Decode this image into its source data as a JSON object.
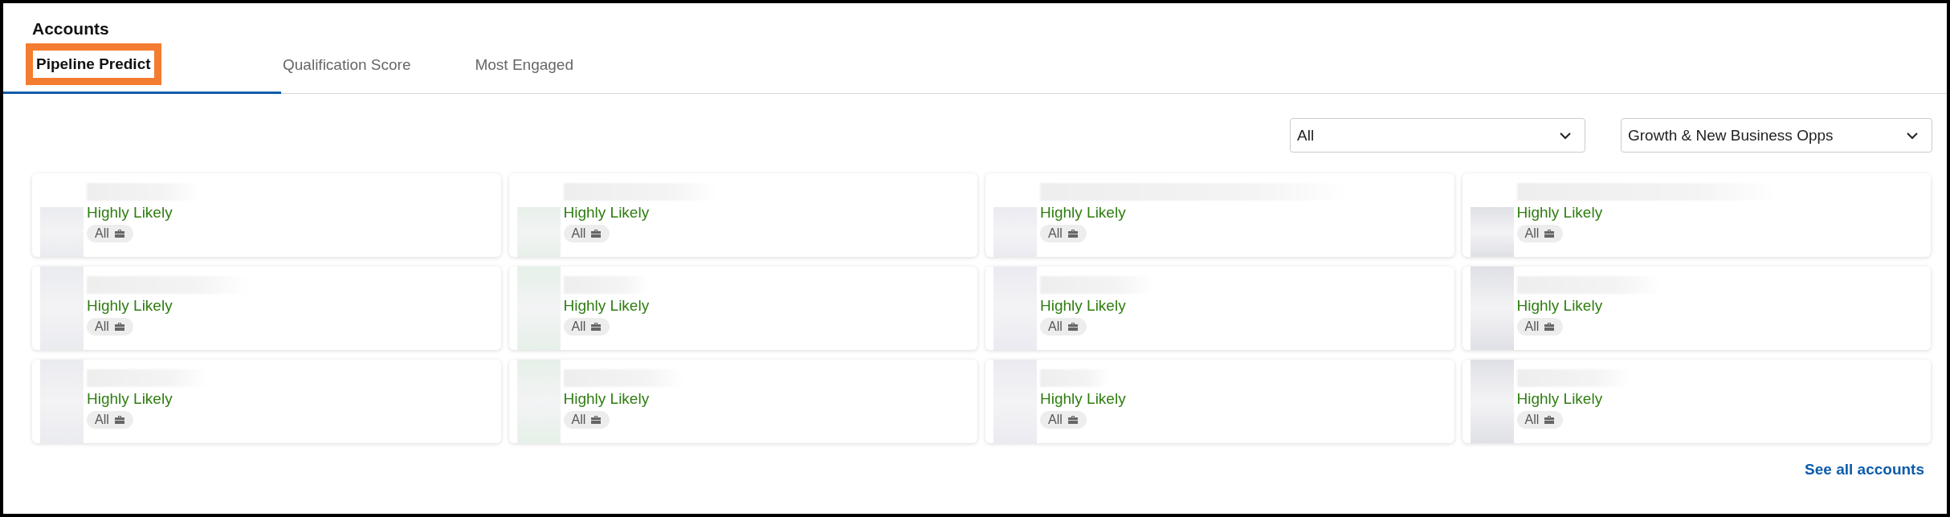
{
  "title": "Accounts",
  "tabs": [
    {
      "label": "Pipeline Predict",
      "selected": true,
      "highlighted": true
    },
    {
      "label": "Qualification Score",
      "selected": false,
      "highlighted": false
    },
    {
      "label": "Most Engaged",
      "selected": false,
      "highlighted": false
    }
  ],
  "filters": [
    {
      "value": "All"
    },
    {
      "value": "Growth & New Business Opps"
    }
  ],
  "cards": [
    {
      "likelihood": "Highly Likely",
      "tag": "All"
    },
    {
      "likelihood": "Highly Likely",
      "tag": "All"
    },
    {
      "likelihood": "Highly Likely",
      "tag": "All"
    },
    {
      "likelihood": "Highly Likely",
      "tag": "All"
    },
    {
      "likelihood": "Highly Likely",
      "tag": "All"
    },
    {
      "likelihood": "Highly Likely",
      "tag": "All"
    },
    {
      "likelihood": "Highly Likely",
      "tag": "All"
    },
    {
      "likelihood": "Highly Likely",
      "tag": "All"
    },
    {
      "likelihood": "Highly Likely",
      "tag": "All"
    },
    {
      "likelihood": "Highly Likely",
      "tag": "All"
    },
    {
      "likelihood": "Highly Likely",
      "tag": "All"
    },
    {
      "likelihood": "Highly Likely",
      "tag": "All"
    }
  ],
  "link": "See all accounts"
}
